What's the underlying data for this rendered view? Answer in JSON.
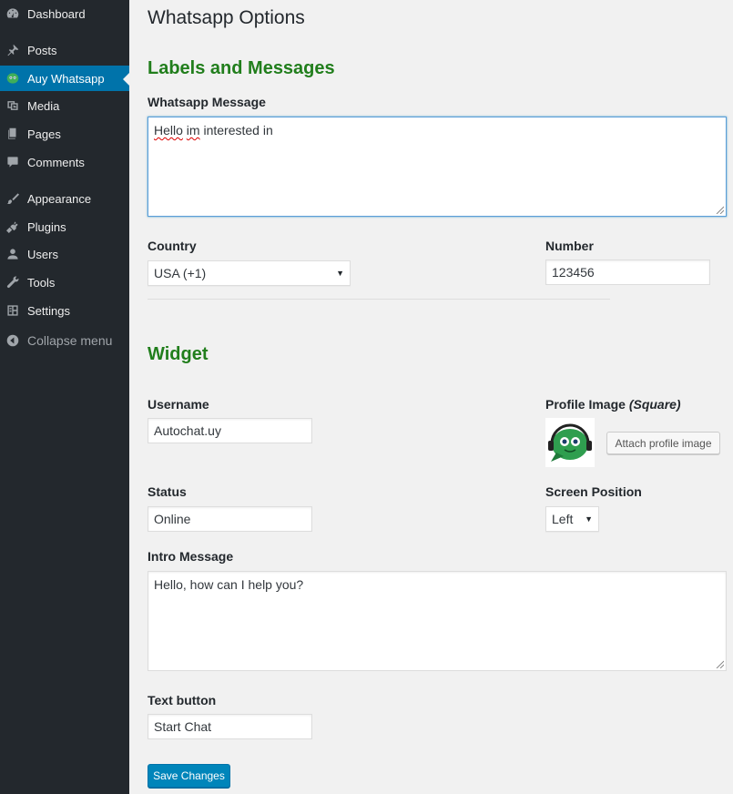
{
  "sidebar": {
    "items": [
      {
        "label": "Dashboard",
        "icon": "dashboard-icon"
      },
      {
        "label": "Posts",
        "icon": "pin-icon"
      },
      {
        "label": "Auy Whatsapp",
        "icon": "chat-bot-icon",
        "active": true
      },
      {
        "label": "Media",
        "icon": "media-icon"
      },
      {
        "label": "Pages",
        "icon": "pages-icon"
      },
      {
        "label": "Comments",
        "icon": "comment-icon"
      },
      {
        "label": "Appearance",
        "icon": "brush-icon"
      },
      {
        "label": "Plugins",
        "icon": "plugin-icon"
      },
      {
        "label": "Users",
        "icon": "user-icon"
      },
      {
        "label": "Tools",
        "icon": "wrench-icon"
      },
      {
        "label": "Settings",
        "icon": "settings-icon"
      }
    ],
    "collapse_label": "Collapse menu"
  },
  "page": {
    "title": "Whatsapp Options",
    "labels_section": "Labels and Messages",
    "whatsapp_message_label": "Whatsapp Message",
    "whatsapp_message_value_word1": "Hello",
    "whatsapp_message_value_word2": "im",
    "whatsapp_message_value_rest": "interested in",
    "country_label": "Country",
    "country_value": "USA (+1)",
    "number_label": "Number",
    "number_value": "123456",
    "widget_section": "Widget",
    "username_label": "Username",
    "username_value": "Autochat.uy",
    "profile_image_label": "Profile Image",
    "profile_image_note": "(Square)",
    "attach_button": "Attach profile image",
    "status_label": "Status",
    "status_value": "Online",
    "screen_position_label": "Screen Position",
    "screen_position_value": "Left",
    "intro_label": "Intro Message",
    "intro_value": "Hello, how can I help you?",
    "text_button_label": "Text button",
    "text_button_value": "Start Chat",
    "save_button": "Save Changes"
  },
  "colors": {
    "sidebar_bg": "#23282d",
    "active_bg": "#0073aa",
    "section_green": "#217e1c",
    "primary_button": "#0085ba",
    "page_bg": "#f1f1f1"
  }
}
